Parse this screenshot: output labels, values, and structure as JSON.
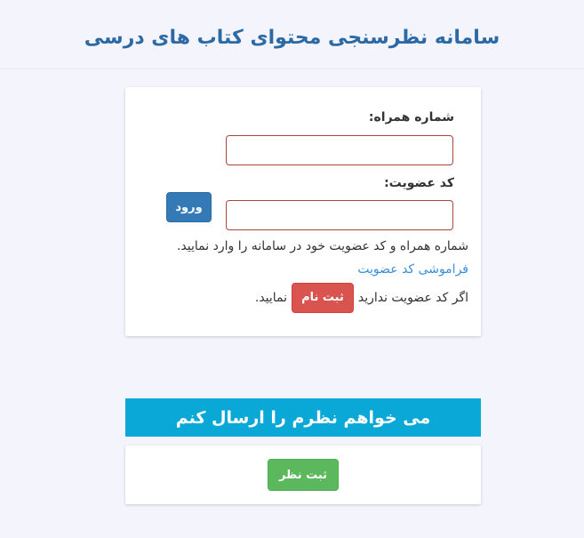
{
  "header": {
    "title": "سامانه نظرسنجی محتوای کتاب های درسی"
  },
  "login": {
    "mobile_label": "شماره همراه:",
    "mobile_value": "",
    "code_label": "کد عضویت:",
    "code_value": "",
    "login_button": "ورود",
    "help_text": "شماره همراه و کد عضویت خود در سامانه را وارد نمایید.",
    "forgot_link": "فراموشی کد عضویت",
    "register_prefix": "اگر کد عضویت ندارید",
    "register_button": "ثبت نام",
    "register_suffix": "نمایید."
  },
  "opinion": {
    "banner_text": "می خواهم نظرم را ارسال کنم",
    "submit_button": "ثبت نظر"
  },
  "colors": {
    "title": "#2c6aa6",
    "login_button": "#337ab7",
    "register_button": "#d9534f",
    "banner": "#0aa8d6",
    "submit_button": "#5cb85c",
    "input_border_error": "#a94442",
    "link": "#3a8fd9"
  }
}
